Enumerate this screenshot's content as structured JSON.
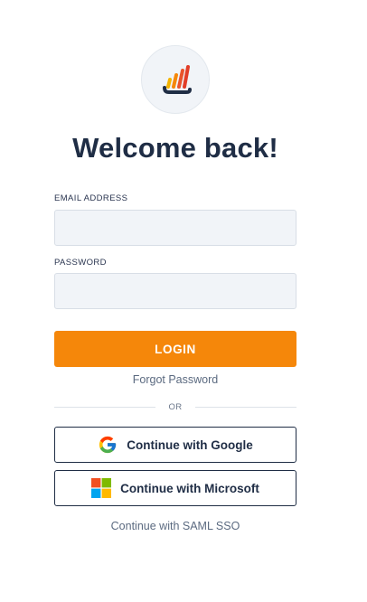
{
  "header": {
    "title": "Welcome back!",
    "logo_icon": "bar-chart-logo-icon"
  },
  "form": {
    "email_label": "EMAIL ADDRESS",
    "email_value": "",
    "email_placeholder": "",
    "password_label": "PASSWORD",
    "password_value": "",
    "password_placeholder": "",
    "login_label": "LOGIN",
    "forgot_label": "Forgot Password"
  },
  "divider": {
    "text": "OR"
  },
  "oauth": {
    "google_label": "Continue with Google",
    "google_icon": "google-icon",
    "microsoft_label": "Continue with Microsoft",
    "microsoft_icon": "microsoft-icon",
    "saml_label": "Continue with SAML SSO"
  },
  "colors": {
    "accent": "#f5870a",
    "text_primary": "#1f2d45",
    "text_muted": "#5b6a80",
    "input_bg": "#f1f4f8"
  }
}
